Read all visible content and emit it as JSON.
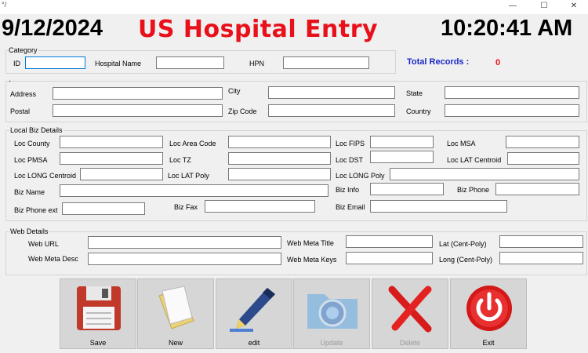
{
  "window": {
    "app_icon": "°/",
    "minimize": "—",
    "maximize": "☐",
    "close": "✕"
  },
  "header": {
    "date": "9/12/2024",
    "title": "US Hospital Entry",
    "time": "10:20:41 AM"
  },
  "category": {
    "group_label": "Category",
    "id_label": "ID",
    "id_value": "",
    "hospital_name_label": "Hospital Name",
    "hospital_name_value": "",
    "hpn_label": "HPN",
    "hpn_value": "",
    "total_records_label": "Total Records :",
    "total_records_value": "0"
  },
  "address": {
    "group_label": "-",
    "address_label": "Address",
    "city_label": "City",
    "state_label": "State",
    "postal_label": "Postal",
    "zip_label": "Zip Code",
    "country_label": "Country"
  },
  "local": {
    "group_label": "Local  Biz Details",
    "loc_county": "Loc County",
    "loc_area_code": "Loc Area Code",
    "loc_fips": "Loc FIPS",
    "loc_msa": "Loc MSA",
    "loc_pmsa": "Loc PMSA",
    "loc_tz": "Loc TZ",
    "loc_dst": "Loc DST",
    "loc_lat_centroid": "Loc LAT Centroid",
    "loc_long_centroid": "Loc LONG Centroid",
    "loc_lat_poly": "Loc LAT Poly",
    "loc_long_poly": "Loc LONG Poly",
    "biz_name": "Biz Name",
    "biz_info": "Biz Info",
    "biz_phone": "Biz Phone",
    "biz_phone_ext": "Biz Phone ext",
    "biz_fax": "Biz Fax",
    "biz_email": "Biz Email"
  },
  "web": {
    "group_label": "Web Details",
    "web_url": "Web URL",
    "web_meta_title": "Web Meta Title",
    "lat_cent_poly": "Lat (Cent-Poly)",
    "web_meta_desc": "Web Meta Desc",
    "web_meta_keys": "Web Meta Keys",
    "long_cent_poly": "Long (Cent-Poly)"
  },
  "toolbar": {
    "save": "Save",
    "new": "New",
    "edit": "edit",
    "update": "Update",
    "delete": "Delete",
    "exit": "Exit",
    "save_icon": "floppy-disk-icon",
    "new_icon": "blank-pages-icon",
    "edit_icon": "pen-icon",
    "update_icon": "folder-globe-icon",
    "delete_icon": "red-x-icon",
    "exit_icon": "power-icon"
  },
  "colors": {
    "title": "#e8101a",
    "total_label": "#1a28c8",
    "total_value": "#e8101a",
    "focus_border": "#0078d7"
  }
}
